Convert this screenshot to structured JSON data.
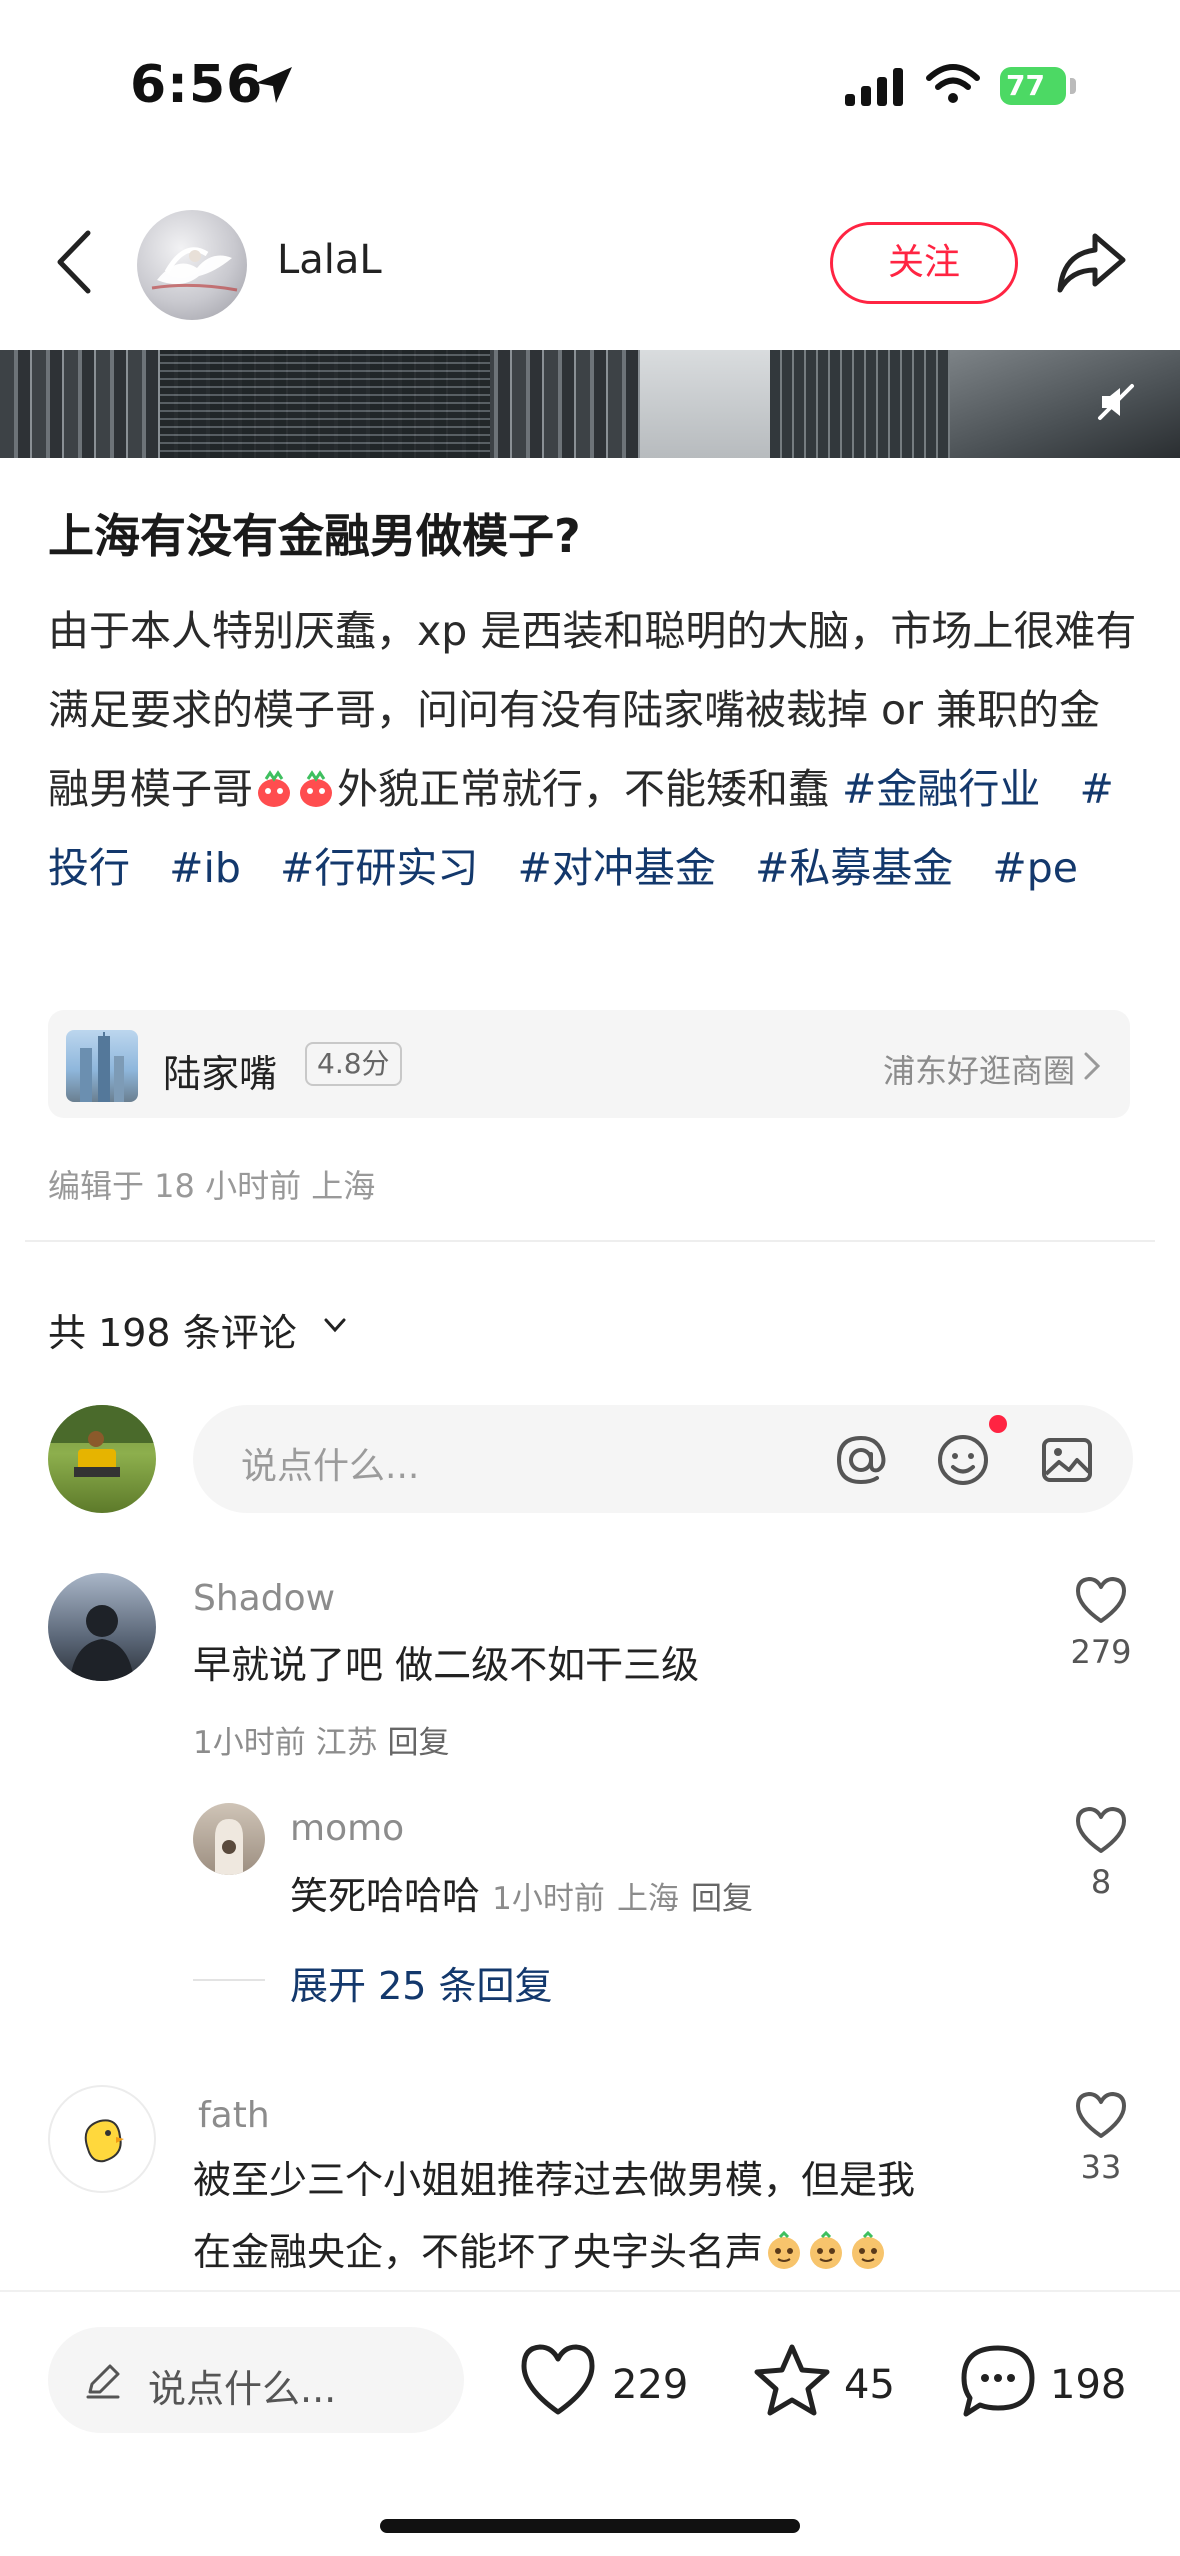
{
  "status_bar": {
    "time": "6:56",
    "battery": "77"
  },
  "header": {
    "author": "LalaL",
    "follow_label": "关注"
  },
  "post": {
    "title": "上海有没有金融男做模子?",
    "body_part1": "由于本人特别厌蠢，xp 是西装和聪明的大脑，市场上很难有满足要求的模子哥，问问有没有陆家嘴被裁掉 or 兼职的金融男模子哥",
    "body_part2": "外貌正常就行，不能矮和蠢",
    "tags": [
      "#金融行业",
      "#投行",
      "#ib",
      "#行研实习",
      "#对冲基金",
      "#私募基金",
      "#pe"
    ]
  },
  "location": {
    "name": "陆家嘴",
    "score": "4.8分",
    "area": "浦东好逛商圈"
  },
  "edit_info": "编辑于 18 小时前 上海",
  "comments_header": "共 198 条评论",
  "comment_input_placeholder": "说点什么...",
  "comments": [
    {
      "name": "Shadow",
      "text": "早就说了吧 做二级不如干三级",
      "time": "1小时前",
      "region": "江苏",
      "reply": "回复",
      "likes": "279"
    },
    {
      "name": "fath",
      "text_line1": "被至少三个小姐姐推荐过去做男模，但是我",
      "text_line2": "在金融央企，不能坏了央字头名声",
      "likes": "33"
    }
  ],
  "sub_comment": {
    "name": "momo",
    "text": "笑死哈哈哈",
    "time": "1小时前",
    "region": "上海",
    "reply": "回复",
    "likes": "8"
  },
  "expand_replies": "展开 25 条回复",
  "bottom_bar": {
    "placeholder": "说点什么...",
    "likes": "229",
    "favorites": "45",
    "comments": "198"
  },
  "colors": {
    "accent": "#ff2442",
    "tag": "#13386c",
    "battery": "#4cd964"
  }
}
